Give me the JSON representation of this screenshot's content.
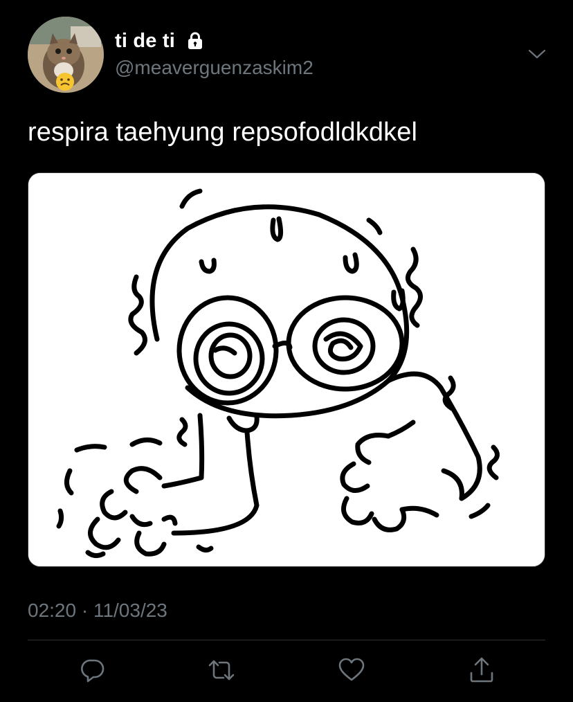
{
  "tweet": {
    "display_name": "ti de ti",
    "handle": "@meaverguenzaskim2",
    "text": "respira taehyung repsofodldkdkel",
    "timestamp": "02:20 · 11/03/23",
    "protected": true
  },
  "icons": {
    "lock": "lock-icon",
    "chevron": "chevron-down-icon",
    "reply": "reply-icon",
    "retweet": "retweet-icon",
    "like": "heart-icon",
    "share": "share-icon"
  },
  "colors": {
    "background": "#000000",
    "text_primary": "#ffffff",
    "text_secondary": "#6e767d",
    "divider": "#2f3336"
  }
}
